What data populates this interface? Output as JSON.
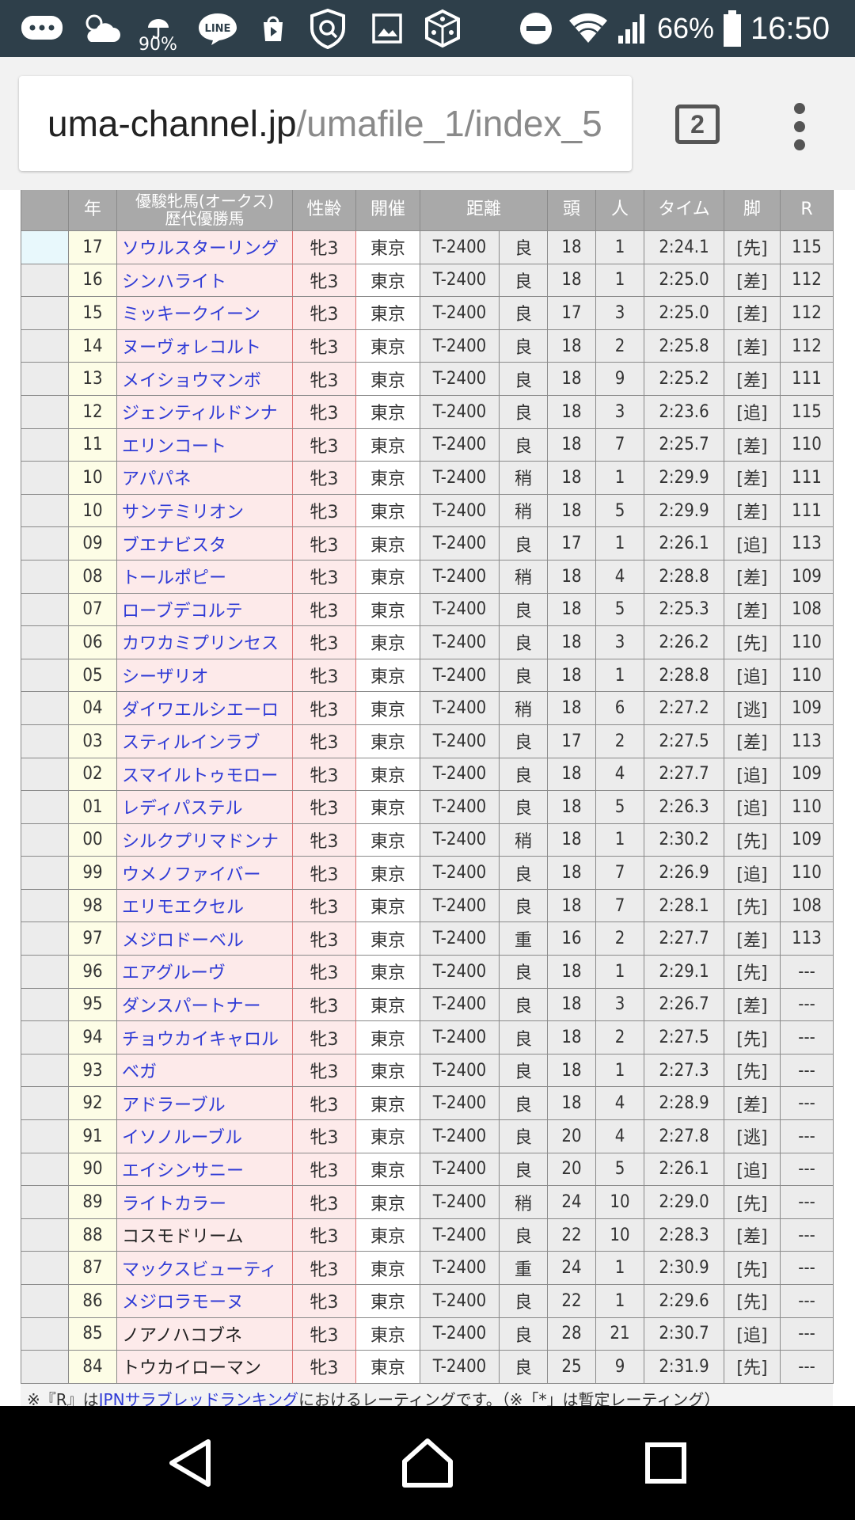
{
  "status_bar": {
    "weather_precip": "90%",
    "battery": "66%",
    "time": "16:50"
  },
  "browser": {
    "url_host": "uma-channel.jp",
    "url_path": "/umafile_1/index_5",
    "tab_count": "2"
  },
  "table": {
    "headers": {
      "year": "年",
      "name_line1": "優駿牝馬(オークス)",
      "name_line2": "歴代優勝馬",
      "sex_age": "性齢",
      "venue": "開催",
      "distance": "距離",
      "heads": "頭",
      "popularity": "人",
      "time": "タイム",
      "style": "脚",
      "rating": "R"
    },
    "rows": [
      {
        "year": "17",
        "name": "ソウルスターリング",
        "link": true,
        "sex": "牝3",
        "venue": "東京",
        "dist": "T-2400",
        "cond": "良",
        "heads": "18",
        "pop": "1",
        "time": "2:24.1",
        "style": "[先]",
        "r": "115"
      },
      {
        "year": "16",
        "name": "シンハライト",
        "link": true,
        "sex": "牝3",
        "venue": "東京",
        "dist": "T-2400",
        "cond": "良",
        "heads": "18",
        "pop": "1",
        "time": "2:25.0",
        "style": "[差]",
        "r": "112"
      },
      {
        "year": "15",
        "name": "ミッキークイーン",
        "link": true,
        "sex": "牝3",
        "venue": "東京",
        "dist": "T-2400",
        "cond": "良",
        "heads": "17",
        "pop": "3",
        "time": "2:25.0",
        "style": "[差]",
        "r": "112"
      },
      {
        "year": "14",
        "name": "ヌーヴォレコルト",
        "link": true,
        "sex": "牝3",
        "venue": "東京",
        "dist": "T-2400",
        "cond": "良",
        "heads": "18",
        "pop": "2",
        "time": "2:25.8",
        "style": "[差]",
        "r": "112"
      },
      {
        "year": "13",
        "name": "メイショウマンボ",
        "link": true,
        "sex": "牝3",
        "venue": "東京",
        "dist": "T-2400",
        "cond": "良",
        "heads": "18",
        "pop": "9",
        "time": "2:25.2",
        "style": "[差]",
        "r": "111"
      },
      {
        "year": "12",
        "name": "ジェンティルドンナ",
        "link": true,
        "sex": "牝3",
        "venue": "東京",
        "dist": "T-2400",
        "cond": "良",
        "heads": "18",
        "pop": "3",
        "time": "2:23.6",
        "style": "[追]",
        "r": "115"
      },
      {
        "year": "11",
        "name": "エリンコート",
        "link": true,
        "sex": "牝3",
        "venue": "東京",
        "dist": "T-2400",
        "cond": "良",
        "heads": "18",
        "pop": "7",
        "time": "2:25.7",
        "style": "[差]",
        "r": "110"
      },
      {
        "year": "10",
        "name": "アパパネ",
        "link": true,
        "sex": "牝3",
        "venue": "東京",
        "dist": "T-2400",
        "cond": "稍",
        "heads": "18",
        "pop": "1",
        "time": "2:29.9",
        "style": "[差]",
        "r": "111"
      },
      {
        "year": "10",
        "name": "サンテミリオン",
        "link": true,
        "sex": "牝3",
        "venue": "東京",
        "dist": "T-2400",
        "cond": "稍",
        "heads": "18",
        "pop": "5",
        "time": "2:29.9",
        "style": "[差]",
        "r": "111"
      },
      {
        "year": "09",
        "name": "ブエナビスタ",
        "link": true,
        "sex": "牝3",
        "venue": "東京",
        "dist": "T-2400",
        "cond": "良",
        "heads": "17",
        "pop": "1",
        "time": "2:26.1",
        "style": "[追]",
        "r": "113"
      },
      {
        "year": "08",
        "name": "トールポピー",
        "link": true,
        "sex": "牝3",
        "venue": "東京",
        "dist": "T-2400",
        "cond": "稍",
        "heads": "18",
        "pop": "4",
        "time": "2:28.8",
        "style": "[差]",
        "r": "109"
      },
      {
        "year": "07",
        "name": "ローブデコルテ",
        "link": true,
        "sex": "牝3",
        "venue": "東京",
        "dist": "T-2400",
        "cond": "良",
        "heads": "18",
        "pop": "5",
        "time": "2:25.3",
        "style": "[差]",
        "r": "108"
      },
      {
        "year": "06",
        "name": "カワカミプリンセス",
        "link": true,
        "sex": "牝3",
        "venue": "東京",
        "dist": "T-2400",
        "cond": "良",
        "heads": "18",
        "pop": "3",
        "time": "2:26.2",
        "style": "[先]",
        "r": "110"
      },
      {
        "year": "05",
        "name": "シーザリオ",
        "link": true,
        "sex": "牝3",
        "venue": "東京",
        "dist": "T-2400",
        "cond": "良",
        "heads": "18",
        "pop": "1",
        "time": "2:28.8",
        "style": "[追]",
        "r": "110"
      },
      {
        "year": "04",
        "name": "ダイワエルシエーロ",
        "link": true,
        "sex": "牝3",
        "venue": "東京",
        "dist": "T-2400",
        "cond": "稍",
        "heads": "18",
        "pop": "6",
        "time": "2:27.2",
        "style": "[逃]",
        "r": "109"
      },
      {
        "year": "03",
        "name": "スティルインラブ",
        "link": true,
        "sex": "牝3",
        "venue": "東京",
        "dist": "T-2400",
        "cond": "良",
        "heads": "17",
        "pop": "2",
        "time": "2:27.5",
        "style": "[差]",
        "r": "113"
      },
      {
        "year": "02",
        "name": "スマイルトゥモロー",
        "link": true,
        "sex": "牝3",
        "venue": "東京",
        "dist": "T-2400",
        "cond": "良",
        "heads": "18",
        "pop": "4",
        "time": "2:27.7",
        "style": "[追]",
        "r": "109"
      },
      {
        "year": "01",
        "name": "レディパステル",
        "link": true,
        "sex": "牝3",
        "venue": "東京",
        "dist": "T-2400",
        "cond": "良",
        "heads": "18",
        "pop": "5",
        "time": "2:26.3",
        "style": "[追]",
        "r": "110"
      },
      {
        "year": "00",
        "name": "シルクプリマドンナ",
        "link": true,
        "sex": "牝3",
        "venue": "東京",
        "dist": "T-2400",
        "cond": "稍",
        "heads": "18",
        "pop": "1",
        "time": "2:30.2",
        "style": "[先]",
        "r": "109"
      },
      {
        "year": "99",
        "name": "ウメノファイバー",
        "link": true,
        "sex": "牝3",
        "venue": "東京",
        "dist": "T-2400",
        "cond": "良",
        "heads": "18",
        "pop": "7",
        "time": "2:26.9",
        "style": "[追]",
        "r": "110"
      },
      {
        "year": "98",
        "name": "エリモエクセル",
        "link": true,
        "sex": "牝3",
        "venue": "東京",
        "dist": "T-2400",
        "cond": "良",
        "heads": "18",
        "pop": "7",
        "time": "2:28.1",
        "style": "[先]",
        "r": "108"
      },
      {
        "year": "97",
        "name": "メジロドーベル",
        "link": true,
        "sex": "牝3",
        "venue": "東京",
        "dist": "T-2400",
        "cond": "重",
        "heads": "16",
        "pop": "2",
        "time": "2:27.7",
        "style": "[差]",
        "r": "113"
      },
      {
        "year": "96",
        "name": "エアグルーヴ",
        "link": true,
        "sex": "牝3",
        "venue": "東京",
        "dist": "T-2400",
        "cond": "良",
        "heads": "18",
        "pop": "1",
        "time": "2:29.1",
        "style": "[先]",
        "r": "---"
      },
      {
        "year": "95",
        "name": "ダンスパートナー",
        "link": true,
        "sex": "牝3",
        "venue": "東京",
        "dist": "T-2400",
        "cond": "良",
        "heads": "18",
        "pop": "3",
        "time": "2:26.7",
        "style": "[差]",
        "r": "---"
      },
      {
        "year": "94",
        "name": "チョウカイキャロル",
        "link": true,
        "sex": "牝3",
        "venue": "東京",
        "dist": "T-2400",
        "cond": "良",
        "heads": "18",
        "pop": "2",
        "time": "2:27.5",
        "style": "[先]",
        "r": "---"
      },
      {
        "year": "93",
        "name": "ベガ",
        "link": true,
        "sex": "牝3",
        "venue": "東京",
        "dist": "T-2400",
        "cond": "良",
        "heads": "18",
        "pop": "1",
        "time": "2:27.3",
        "style": "[先]",
        "r": "---"
      },
      {
        "year": "92",
        "name": "アドラーブル",
        "link": true,
        "sex": "牝3",
        "venue": "東京",
        "dist": "T-2400",
        "cond": "良",
        "heads": "18",
        "pop": "4",
        "time": "2:28.9",
        "style": "[差]",
        "r": "---"
      },
      {
        "year": "91",
        "name": "イソノルーブル",
        "link": true,
        "sex": "牝3",
        "venue": "東京",
        "dist": "T-2400",
        "cond": "良",
        "heads": "20",
        "pop": "4",
        "time": "2:27.8",
        "style": "[逃]",
        "r": "---"
      },
      {
        "year": "90",
        "name": "エイシンサニー",
        "link": true,
        "sex": "牝3",
        "venue": "東京",
        "dist": "T-2400",
        "cond": "良",
        "heads": "20",
        "pop": "5",
        "time": "2:26.1",
        "style": "[追]",
        "r": "---"
      },
      {
        "year": "89",
        "name": "ライトカラー",
        "link": true,
        "sex": "牝3",
        "venue": "東京",
        "dist": "T-2400",
        "cond": "稍",
        "heads": "24",
        "pop": "10",
        "time": "2:29.0",
        "style": "[先]",
        "r": "---"
      },
      {
        "year": "88",
        "name": "コスモドリーム",
        "link": false,
        "sex": "牝3",
        "venue": "東京",
        "dist": "T-2400",
        "cond": "良",
        "heads": "22",
        "pop": "10",
        "time": "2:28.3",
        "style": "[差]",
        "r": "---"
      },
      {
        "year": "87",
        "name": "マックスビューティ",
        "link": true,
        "sex": "牝3",
        "venue": "東京",
        "dist": "T-2400",
        "cond": "重",
        "heads": "24",
        "pop": "1",
        "time": "2:30.9",
        "style": "[先]",
        "r": "---"
      },
      {
        "year": "86",
        "name": "メジロラモーヌ",
        "link": true,
        "sex": "牝3",
        "venue": "東京",
        "dist": "T-2400",
        "cond": "良",
        "heads": "22",
        "pop": "1",
        "time": "2:29.6",
        "style": "[先]",
        "r": "---"
      },
      {
        "year": "85",
        "name": "ノアノハコブネ",
        "link": false,
        "sex": "牝3",
        "venue": "東京",
        "dist": "T-2400",
        "cond": "良",
        "heads": "28",
        "pop": "21",
        "time": "2:30.7",
        "style": "[追]",
        "r": "---"
      },
      {
        "year": "84",
        "name": "トウカイローマン",
        "link": false,
        "sex": "牝3",
        "venue": "東京",
        "dist": "T-2400",
        "cond": "良",
        "heads": "25",
        "pop": "9",
        "time": "2:31.9",
        "style": "[先]",
        "r": "---"
      }
    ]
  },
  "footnote": {
    "prefix": "※『R』は",
    "link": "JPNサラブレッドランキング",
    "suffix": "におけるレーティングです。（※「*」は暫定レーティング）"
  },
  "colors": {
    "status_bar": "#2e3f4a",
    "header_bg": "#a9a9a9",
    "link": "#2f3bd6",
    "name_cell_bg": "#fdeaea",
    "year_cell_bg": "#fdfde6"
  }
}
